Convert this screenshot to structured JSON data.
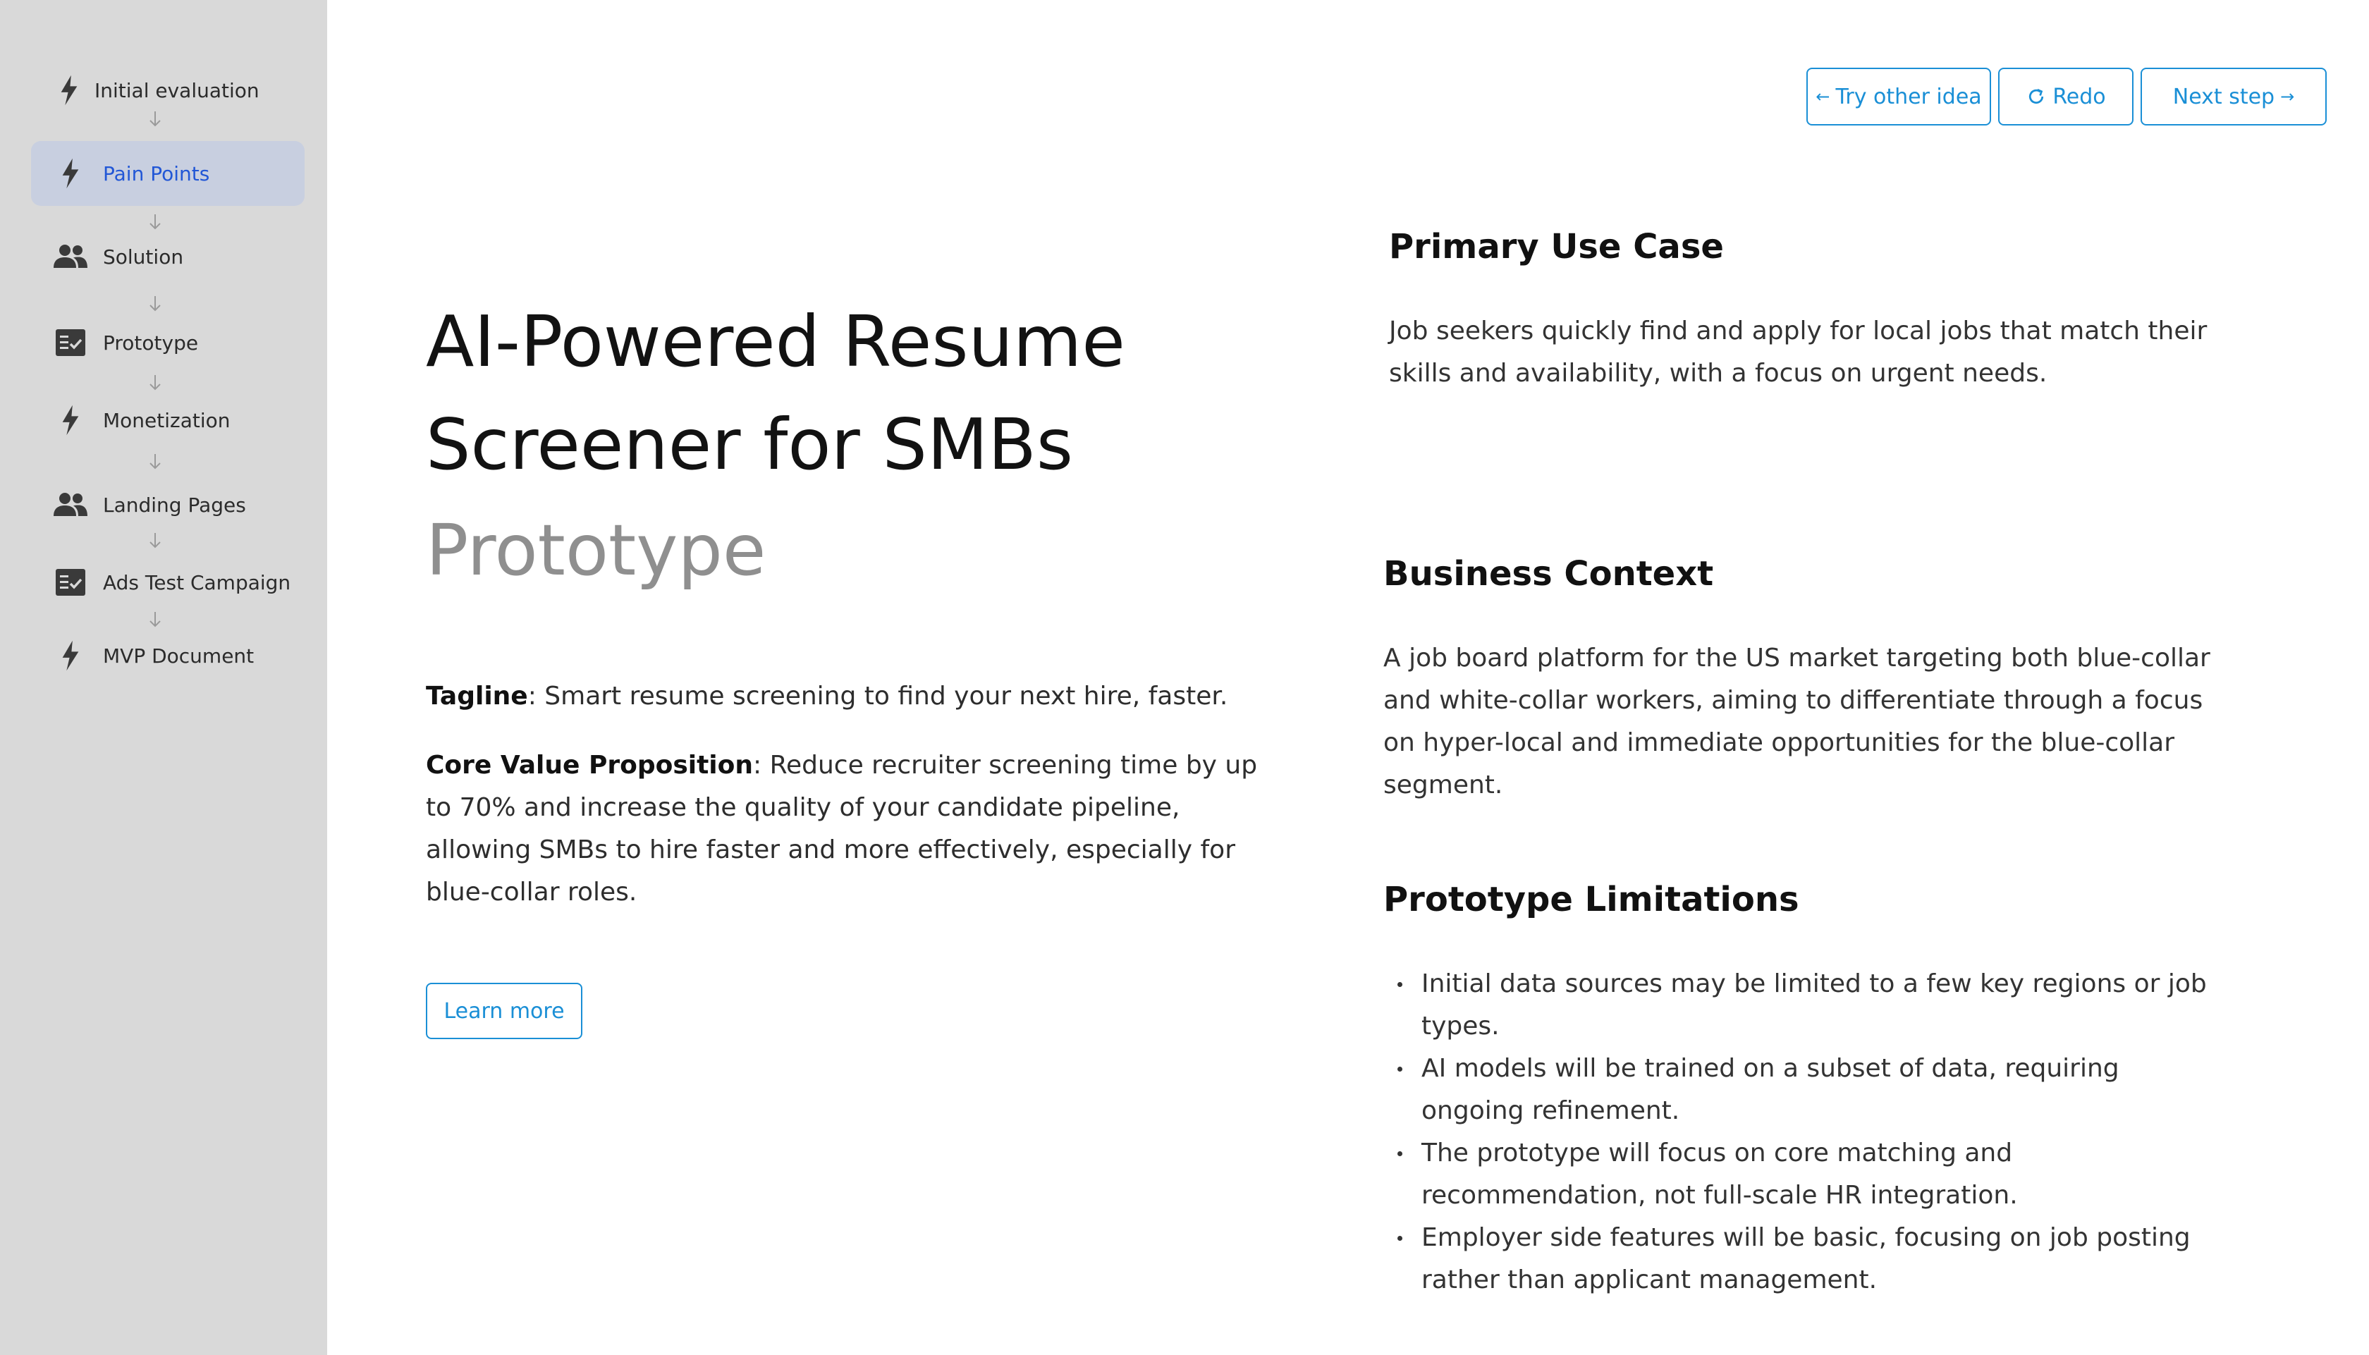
{
  "sidebar": {
    "items": [
      {
        "label": "Initial evaluation",
        "icon": "bolt-icon"
      },
      {
        "label": "Pain Points",
        "icon": "bolt-icon",
        "active": true
      },
      {
        "label": "Solution",
        "icon": "people-icon"
      },
      {
        "label": "Prototype",
        "icon": "checklist-icon"
      },
      {
        "label": "Monetization",
        "icon": "bolt-icon"
      },
      {
        "label": "Landing Pages",
        "icon": "people-icon"
      },
      {
        "label": "Ads Test Campaign",
        "icon": "checklist-icon"
      },
      {
        "label": "MVP Document",
        "icon": "bolt-icon"
      }
    ]
  },
  "toolbar": {
    "try_other_label": "Try other idea",
    "redo_label": "Redo",
    "next_step_label": "Next step"
  },
  "main": {
    "title_line_1": "AI-Powered Resume",
    "title_line_2": "Screener for SMBs",
    "subtitle": "Prototype",
    "tagline_label": "Tagline",
    "tagline_text": ": Smart resume screening to find your next hire, faster.",
    "cvp_label": "Core Value Proposition",
    "cvp_text": ": Reduce recruiter screening time by up to 70% and increase the quality of your candidate pipeline, allowing SMBs to hire faster and more effectively, especially for blue-collar roles.",
    "learn_more_label": "Learn more"
  },
  "details": {
    "primary_use_case": {
      "heading": "Primary Use Case",
      "body": "Job seekers quickly find and apply for local jobs that match their skills and availability, with a focus on urgent needs."
    },
    "business_context": {
      "heading": "Business Context",
      "body": "A job board platform for the US market targeting both blue-collar and white-collar workers, aiming to differentiate through a focus on hyper-local and immediate opportunities for the blue-collar segment."
    },
    "limitations": {
      "heading": "Prototype Limitations",
      "items": [
        "Initial data sources may be limited to a few key regions or job types.",
        "AI models will be trained on a subset of data, requiring ongoing refinement.",
        "The prototype will focus on core matching and recommendation, not full-scale HR integration.",
        "Employer side features will be basic, focusing on job posting rather than applicant management."
      ]
    }
  },
  "colors": {
    "sidebar_bg": "#d9d9d9",
    "active_item_bg": "#c8cfe0",
    "active_item_text": "#2257d6",
    "accent": "#1a8fd6"
  }
}
